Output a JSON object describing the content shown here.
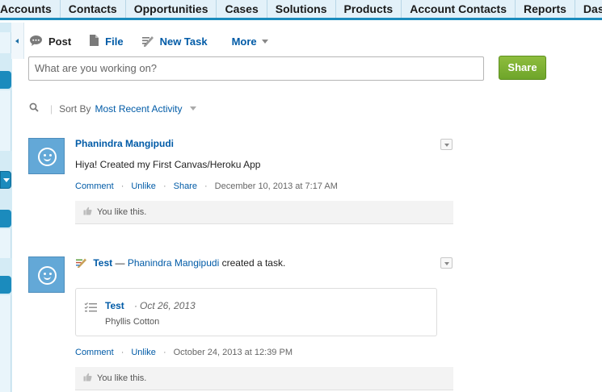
{
  "nav": {
    "tabs": [
      "Accounts",
      "Contacts",
      "Opportunities",
      "Cases",
      "Solutions",
      "Products",
      "Account Contacts",
      "Reports",
      "Dashboards"
    ]
  },
  "publisher": {
    "tabs": [
      {
        "label": "Post",
        "icon": "speech-bubble-icon"
      },
      {
        "label": "File",
        "icon": "file-icon"
      },
      {
        "label": "New Task",
        "icon": "task-icon"
      },
      {
        "label": "More",
        "icon": "chevron-down-icon"
      }
    ],
    "placeholder": "What are you working on?",
    "share_label": "Share"
  },
  "sort": {
    "label": "Sort By",
    "value": "Most Recent Activity"
  },
  "feed": [
    {
      "author": "Phanindra Mangipudi",
      "text": "Hiya! Created my First Canvas/Heroku App",
      "actions": [
        "Comment",
        "Unlike",
        "Share"
      ],
      "timestamp": "December 10, 2013 at 7:17 AM",
      "likes": "You like this."
    },
    {
      "task_name": "Test",
      "dash": "—",
      "author": "Phanindra Mangipudi",
      "action_text": "created a task.",
      "task_card": {
        "name": "Test",
        "separator": "·",
        "date": "Oct 26, 2013",
        "owner": "Phyllis Cotton"
      },
      "actions": [
        "Comment",
        "Unlike"
      ],
      "timestamp": "October 24, 2013 at 12:39 PM",
      "likes": "You like this."
    }
  ],
  "colors": {
    "nav_bg": "#e3f1f9",
    "accent": "#1b8bbd",
    "link": "#015ba7",
    "share_button": "#78ad30",
    "avatar": "#63a8d7"
  }
}
